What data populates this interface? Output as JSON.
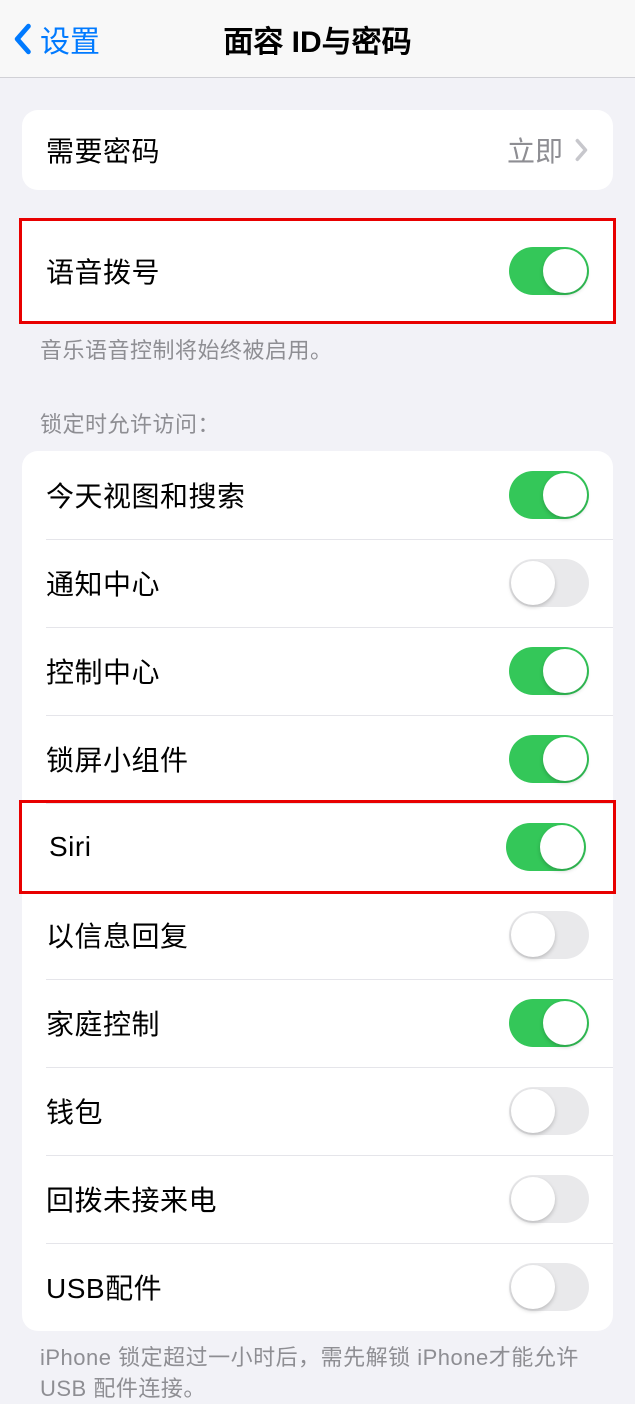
{
  "nav": {
    "back_label": "设置",
    "title": "面容 ID与密码"
  },
  "require_passcode": {
    "label": "需要密码",
    "value": "立即"
  },
  "voice_dial": {
    "label": "语音拨号",
    "footer": "音乐语音控制将始终被启用。",
    "on": true
  },
  "lock_access": {
    "header": "锁定时允许访问：",
    "items": [
      {
        "label": "今天视图和搜索",
        "on": true
      },
      {
        "label": "通知中心",
        "on": false
      },
      {
        "label": "控制中心",
        "on": true
      },
      {
        "label": "锁屏小组件",
        "on": true
      },
      {
        "label": "Siri",
        "on": true,
        "highlight": true
      },
      {
        "label": "以信息回复",
        "on": false
      },
      {
        "label": "家庭控制",
        "on": true
      },
      {
        "label": "钱包",
        "on": false
      },
      {
        "label": "回拨未接来电",
        "on": false
      },
      {
        "label": "USB配件",
        "on": false
      }
    ],
    "footer": "iPhone 锁定超过一小时后，需先解锁 iPhone才能允许USB 配件连接。"
  }
}
